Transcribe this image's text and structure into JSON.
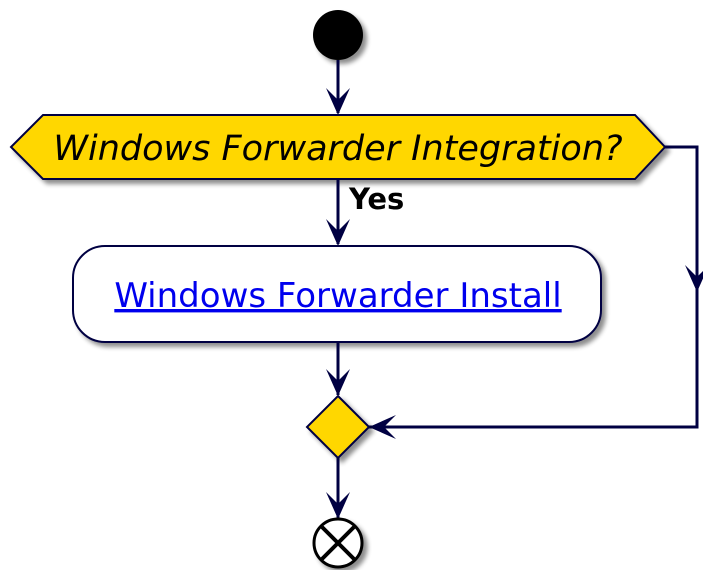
{
  "decision": {
    "question": "Windows Forwarder Integration?",
    "yes_label": "Yes"
  },
  "activity": {
    "link_label": "Windows Forwarder Install"
  },
  "colors": {
    "line": "#000042",
    "decision_fill": "#ffd700",
    "activity_fill": "#ffffff",
    "link": "#0000ee",
    "node": "#000000",
    "shadow": "#888888"
  }
}
